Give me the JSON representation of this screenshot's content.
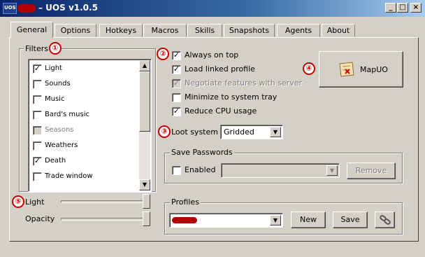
{
  "window": {
    "title": "– UOS v1.0.5",
    "app_icon_text": "UOS",
    "controls": [
      "_",
      "□",
      "×"
    ]
  },
  "tabs": [
    "General",
    "Options",
    "Hotkeys",
    "Macros",
    "Skills",
    "Snapshots",
    "Agents",
    "About"
  ],
  "filters": {
    "label": "Filters",
    "items": [
      {
        "label": "Light",
        "checked": true,
        "enabled": true
      },
      {
        "label": "Sounds",
        "checked": false,
        "enabled": true
      },
      {
        "label": "Music",
        "checked": false,
        "enabled": true
      },
      {
        "label": "Bard's music",
        "checked": false,
        "enabled": true
      },
      {
        "label": "Seasons",
        "checked": false,
        "enabled": false
      },
      {
        "label": "Weathers",
        "checked": false,
        "enabled": true
      },
      {
        "label": "Death",
        "checked": true,
        "enabled": true
      },
      {
        "label": "Trade window",
        "checked": false,
        "enabled": true
      }
    ]
  },
  "options": [
    {
      "label": "Always on top",
      "checked": true,
      "enabled": true
    },
    {
      "label": "Load linked profile",
      "checked": true,
      "enabled": true
    },
    {
      "label": "Negotiate features with server",
      "checked": true,
      "enabled": false
    },
    {
      "label": "Minimize to system tray",
      "checked": false,
      "enabled": true
    },
    {
      "label": "Reduce CPU usage",
      "checked": true,
      "enabled": true
    }
  ],
  "loot_system": {
    "label": "Loot system",
    "value": "Gridded"
  },
  "mapuo": {
    "label": "MapUO"
  },
  "save_passwords": {
    "group_label": "Save Passwords",
    "enabled_label": "Enabled",
    "enabled_checked": false,
    "remove_label": "Remove"
  },
  "sliders": {
    "light": {
      "label": "Light",
      "value_fraction": 1.0
    },
    "opacity": {
      "label": "Opacity",
      "value_fraction": 1.0
    }
  },
  "profiles": {
    "group_label": "Profiles",
    "new_label": "New",
    "save_label": "Save"
  },
  "annotations": [
    "①",
    "②",
    "③",
    "④",
    "⑤"
  ],
  "colors": {
    "annotation_red": "#c40000",
    "redaction": "#b20000",
    "titlebar_start": "#0a246a"
  }
}
